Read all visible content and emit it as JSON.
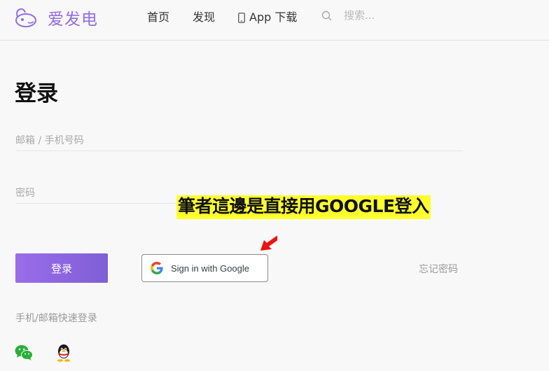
{
  "header": {
    "brand": "爱发电",
    "nav": [
      {
        "label": "首页"
      },
      {
        "label": "发现"
      },
      {
        "label": "App 下载"
      }
    ],
    "search_placeholder": "搜索..."
  },
  "login": {
    "title": "登录",
    "email_placeholder": "邮箱 / 手机号码",
    "password_placeholder": "密码",
    "login_button": "登录",
    "google_button": "Sign in with Google",
    "forgot_password": "忘记密码",
    "quick_login_label": "手机/邮箱快速登录",
    "social_icons": [
      "wechat-icon",
      "qq-icon"
    ]
  },
  "annotation": {
    "text": "筆者這邊是直接用GOOGLE登入"
  },
  "colors": {
    "brand": "#946ce6",
    "button": "#8a66de",
    "highlight": "#ffff2e",
    "arrow": "#ee1111"
  }
}
